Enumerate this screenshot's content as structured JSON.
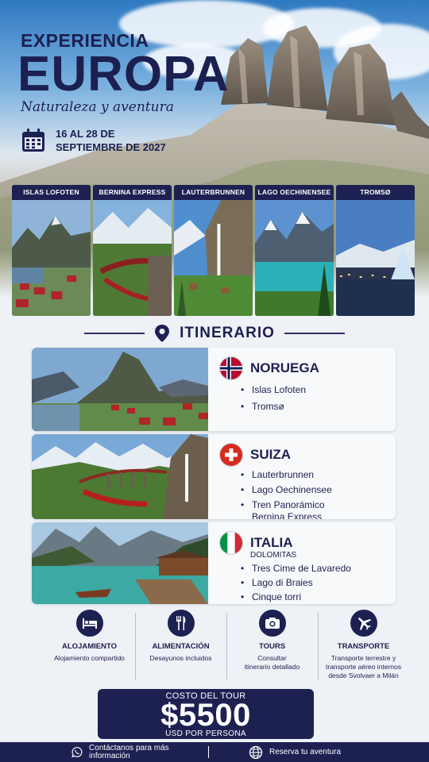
{
  "header": {
    "title_small": "EXPERIENCIA",
    "title_large": "EUROPA",
    "tagline": "Naturaleza y aventura",
    "dates": "16 AL 28 DE SEPTIEMBRE DE 2027",
    "calendar_icon": "calendar-icon"
  },
  "photo_cards": [
    {
      "label": "ISLAS LOFOTEN"
    },
    {
      "label": "BERNINA EXPRESS"
    },
    {
      "label": "LAUTERBRUNNEN"
    },
    {
      "label": "LAGO OECHINENSEE"
    },
    {
      "label": "TROMSØ"
    }
  ],
  "itinerary": {
    "title": "ITINERARIO",
    "icon": "location-pin-icon",
    "countries": [
      {
        "name": "NORUEGA",
        "subtitle": "",
        "places": [
          "Islas Lofoten",
          "Tromsø"
        ]
      },
      {
        "name": "SUIZA",
        "subtitle": "",
        "places": [
          "Lauterbrunnen",
          "Lago Oechinensee",
          "Tren Panorámico Bernina Express"
        ]
      },
      {
        "name": "ITALIA",
        "subtitle": "DOLOMITAS",
        "places": [
          "Tres Cime de Lavaredo",
          "Lago di Braies",
          "Cinque torri"
        ]
      }
    ]
  },
  "services": [
    {
      "icon": "bed-icon",
      "title": "ALOJAMIENTO",
      "desc": "Alojamiento compartido"
    },
    {
      "icon": "cutlery-icon",
      "title": "ALIMENTACIÓN",
      "desc": "Desayunos incluidos"
    },
    {
      "icon": "camera-icon",
      "title": "TOURS",
      "desc": "Consultar itinerario detallado"
    },
    {
      "icon": "airplane-icon",
      "title": "TRANSPORTE",
      "desc": "Transporte terrestre y transporte aéreo internos desde Svolvaer a Milán"
    }
  ],
  "price": {
    "label": "COSTO DEL TOUR",
    "amount": "$5500",
    "per": "USD POR PERSONA"
  },
  "footer": {
    "contact": "Contáctanos para más información",
    "contact_icon": "whatsapp-icon",
    "reserve": "Reserva tu aventura",
    "reserve_icon": "globe-icon"
  },
  "colors": {
    "navy": "#1d2152",
    "background": "#eef1f5",
    "norway_red": "#ba0c2f",
    "swiss_red": "#d52b1e",
    "italy_green": "#009246"
  }
}
